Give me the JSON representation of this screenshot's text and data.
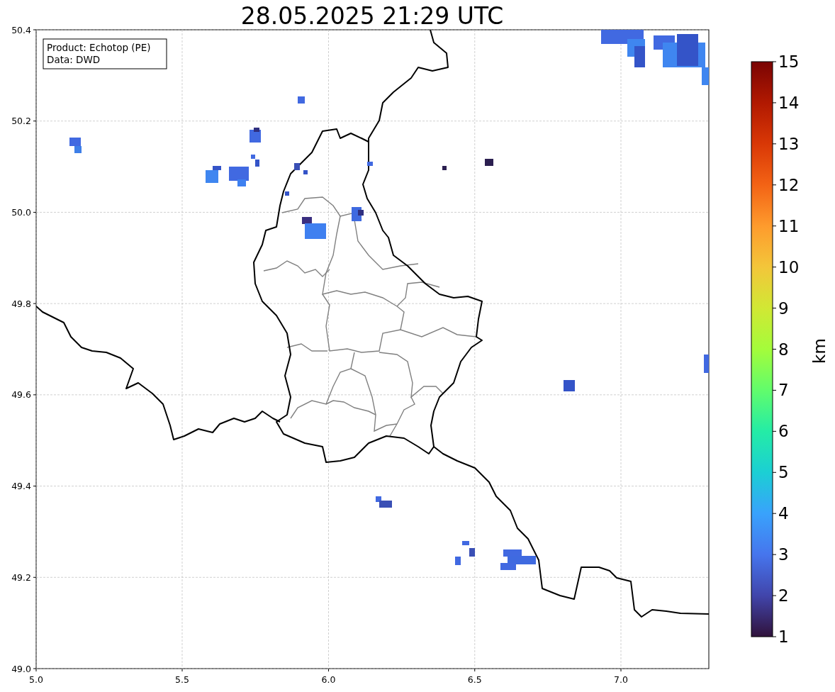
{
  "title": "28.05.2025 21:29 UTC",
  "info_box": [
    "Product: Echotop (PE)",
    "Data: DWD"
  ],
  "x_ticks": [
    "5.0",
    "5.5",
    "6.0",
    "6.5",
    "7.0"
  ],
  "y_ticks": [
    "50.4",
    "50.2",
    "50.0",
    "49.8",
    "49.6",
    "49.4",
    "49.2",
    "49.0"
  ],
  "colorbar": {
    "label": "km",
    "ticks": [
      "15",
      "14",
      "13",
      "12",
      "11",
      "10",
      "9",
      "8",
      "7",
      "6",
      "5",
      "4",
      "3",
      "2",
      "1"
    ]
  }
}
